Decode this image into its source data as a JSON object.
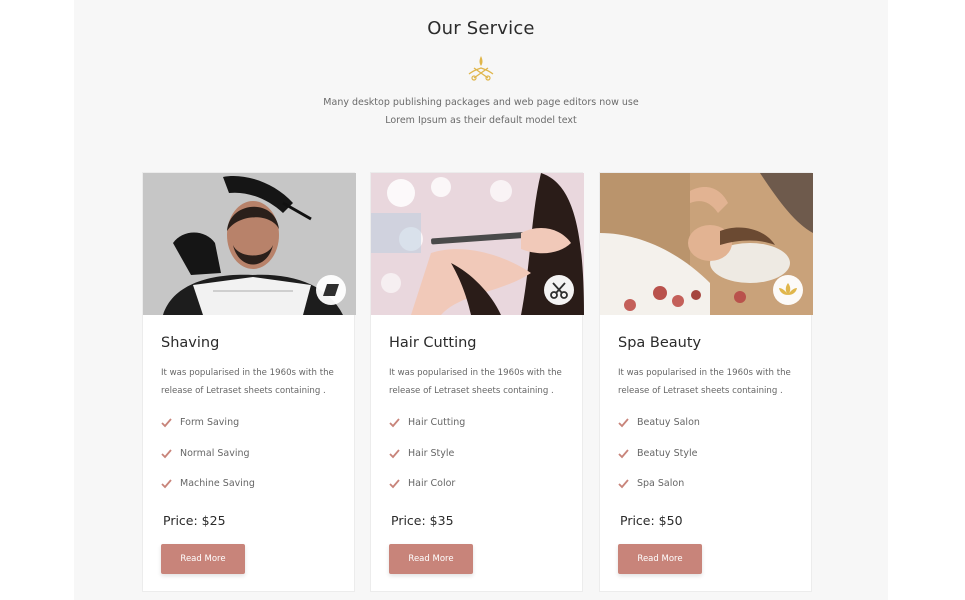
{
  "section": {
    "title": "Our Service",
    "subtitle_line1": "Many desktop publishing packages and web page editors now use",
    "subtitle_line2": "Lorem Ipsum as their default model text"
  },
  "colors": {
    "accent": "#c8847a",
    "gold": "#e0b64b",
    "section_bg": "#f7f7f7"
  },
  "cards": [
    {
      "title": "Shaving",
      "icon": "razor-icon",
      "desc_line1": "It was popularised in the 1960s with the",
      "desc_line2": "release of Letraset sheets containing .",
      "features": [
        "Form Saving",
        "Normal Saving",
        "Machine Saving"
      ],
      "price": "Price: $25",
      "button": "Read More"
    },
    {
      "title": "Hair Cutting",
      "icon": "scissors-icon",
      "desc_line1": "It was popularised in the 1960s with the",
      "desc_line2": "release of Letraset sheets containing .",
      "features": [
        "Hair Cutting",
        "Hair Style",
        "Hair Color"
      ],
      "price": "Price: $35",
      "button": "Read More"
    },
    {
      "title": "Spa Beauty",
      "icon": "lotus-icon",
      "desc_line1": "It was popularised in the 1960s with the",
      "desc_line2": "release of Letraset sheets containing .",
      "features": [
        "Beatuy Salon",
        "Beatuy Style",
        "Spa Salon"
      ],
      "price": "Price: $50",
      "button": "Read More"
    }
  ]
}
